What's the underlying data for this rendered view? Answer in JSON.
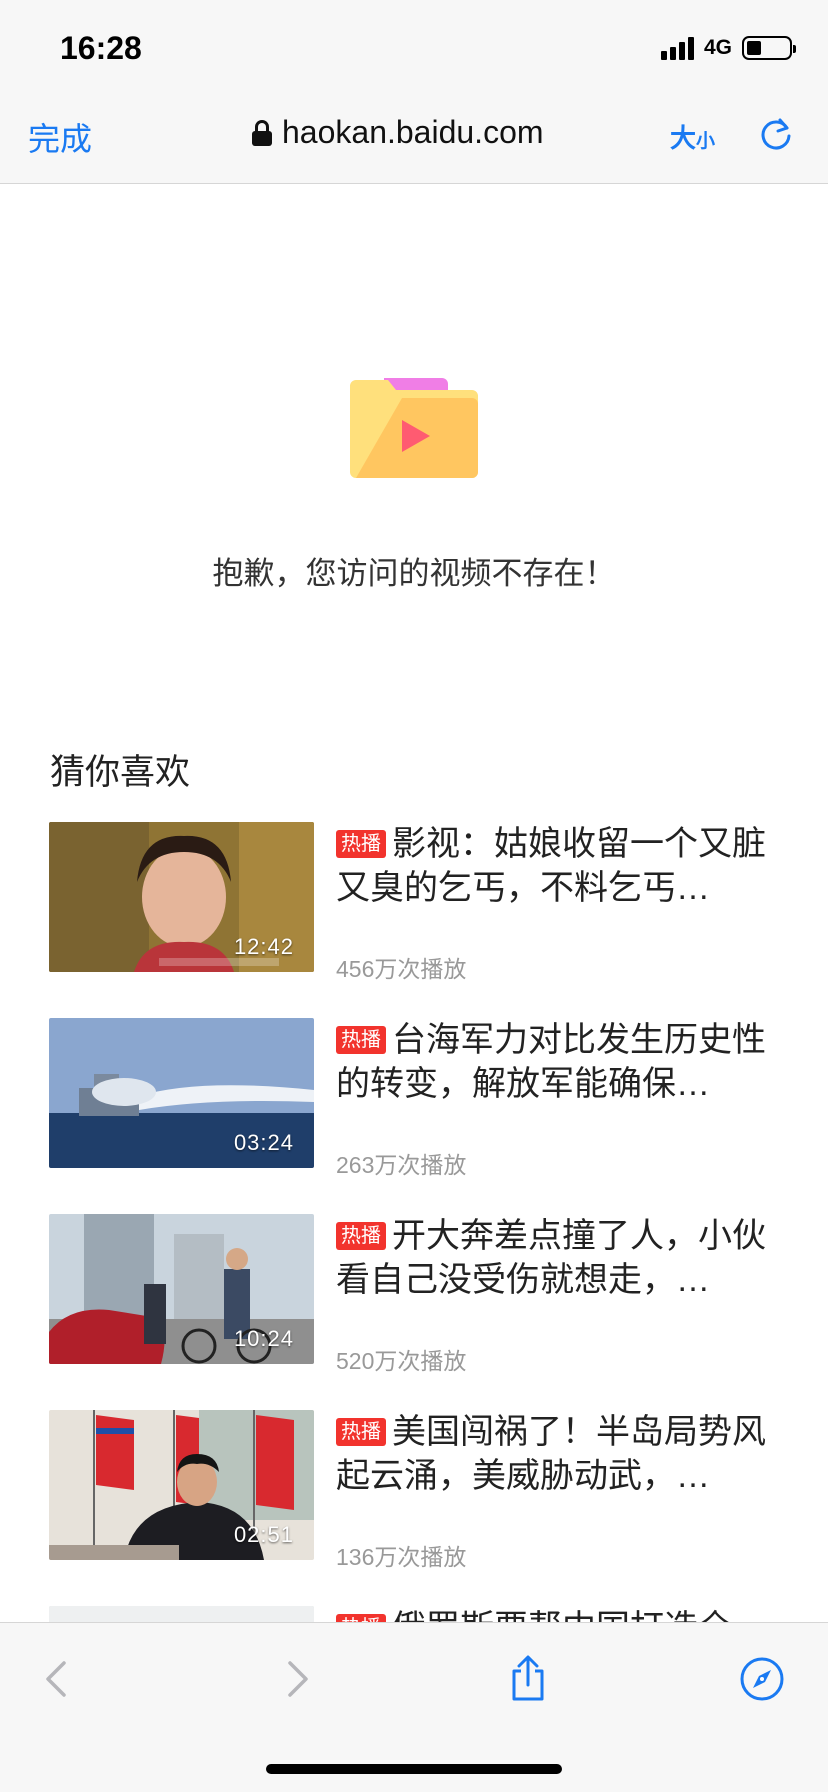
{
  "status": {
    "time": "16:28",
    "network": "4G"
  },
  "browser": {
    "done_label": "完成",
    "url": "haokan.baidu.com",
    "text_size_big": "大",
    "text_size_small": "小"
  },
  "error": {
    "message": "抱歉，您访问的视频不存在！"
  },
  "recommend": {
    "title": "猜你喜欢",
    "items": [
      {
        "badge": "热播",
        "title": "影视：姑娘收留一个又脏又臭的乞丐，不料乞丐…",
        "plays": "456万次播放",
        "duration": "12:42"
      },
      {
        "badge": "热播",
        "title": "台海军力对比发生历史性的转变，解放军能确保…",
        "plays": "263万次播放",
        "duration": "03:24"
      },
      {
        "badge": "热播",
        "title": "开大奔差点撞了人，小伙看自己没受伤就想走，…",
        "plays": "520万次播放",
        "duration": "10:24"
      },
      {
        "badge": "热播",
        "title": "美国闯祸了！半岛局势风起云涌，美威胁动武，…",
        "plays": "136万次播放",
        "duration": "02:51"
      },
      {
        "badge": "热播",
        "title": "俄罗斯要帮中国打造全",
        "plays": "",
        "duration": ""
      }
    ]
  },
  "colors": {
    "accent": "#1a7af2",
    "hot_badge": "#f2332d",
    "plays_text": "#999999"
  },
  "icons": [
    "lock-icon",
    "reload-icon",
    "folder-video-icon",
    "back-icon",
    "forward-icon",
    "share-icon",
    "compass-icon"
  ]
}
